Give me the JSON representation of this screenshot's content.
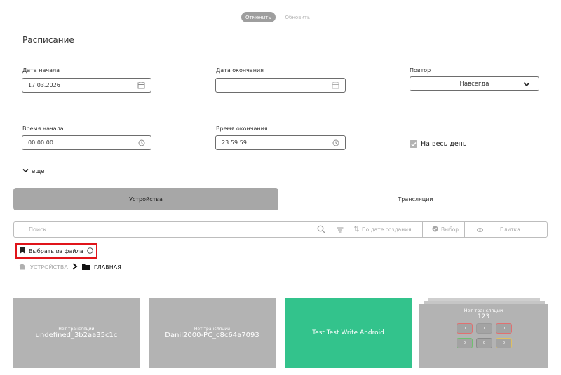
{
  "actions": {
    "cancel": "Отменить",
    "update": "Обновить"
  },
  "schedule": {
    "title": "Расписание",
    "start_date": {
      "label": "Дата начала",
      "value": "17.03.2026"
    },
    "end_date": {
      "label": "Дата окончания",
      "value": ""
    },
    "repeat": {
      "label": "Повтор",
      "value": "Навсегда"
    },
    "start_time": {
      "label": "Время начала",
      "value": "00:00:00"
    },
    "end_time": {
      "label": "Время окончания",
      "value": "23:59:59"
    },
    "all_day": {
      "label": "На весь день",
      "checked": true
    },
    "more": "еще"
  },
  "tabs": [
    {
      "label": "Устройства",
      "active": true
    },
    {
      "label": "Трансляции",
      "active": false
    }
  ],
  "toolbar": {
    "search_placeholder": "Поиск",
    "sort": "По дате создания",
    "select": "Выбор",
    "view": "Плитка"
  },
  "file_select": "Выбрать из файла",
  "breadcrumb": {
    "root": "УСТРОЙСТВА",
    "current": "ГЛАВНАЯ"
  },
  "devices": [
    {
      "status": "Нет трансляции",
      "name": "undefined_3b2aa35c1c"
    },
    {
      "status": "Нет трансляции",
      "name": "Danil2000-PC_c8c64a7093"
    },
    {
      "status": "",
      "name": "Test Test Write Android"
    }
  ],
  "group": {
    "status": "Нет трансляции",
    "name": "123",
    "counts": [
      "0",
      "1",
      "0",
      "0",
      "0",
      "0"
    ],
    "count_colors": [
      "#e07070",
      "#9a9a9a",
      "#e07070",
      "#6fbf6f",
      "#8a8a8a",
      "#e0c060"
    ]
  },
  "colors": {
    "accent_green": "#33c38c",
    "tile_gray": "#b3b3b3",
    "highlight_red": "#e0141a"
  }
}
